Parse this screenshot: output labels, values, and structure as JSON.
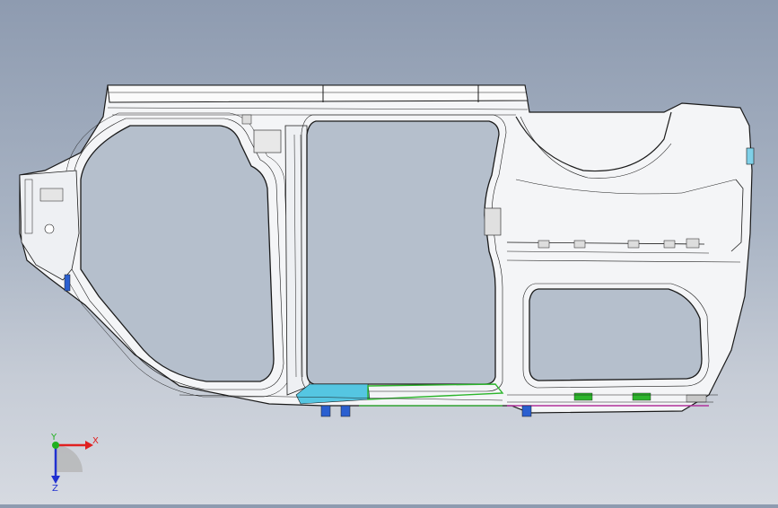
{
  "viewport": {
    "label": "cad-3d-viewport",
    "background_top": "#8e9bb0",
    "background_bottom": "#d6dae1"
  },
  "model": {
    "wire_color": "#1a1a1a",
    "accent_cyan": "#22b8d8",
    "accent_green": "#2db52d",
    "accent_magenta": "#b0309a",
    "accent_blue": "#2a5fd0"
  },
  "triad": {
    "x_label": "X",
    "y_label": "Y",
    "z_label": "Z",
    "x_color": "#e02020",
    "y_color": "#20b020",
    "z_color": "#2030d0"
  }
}
